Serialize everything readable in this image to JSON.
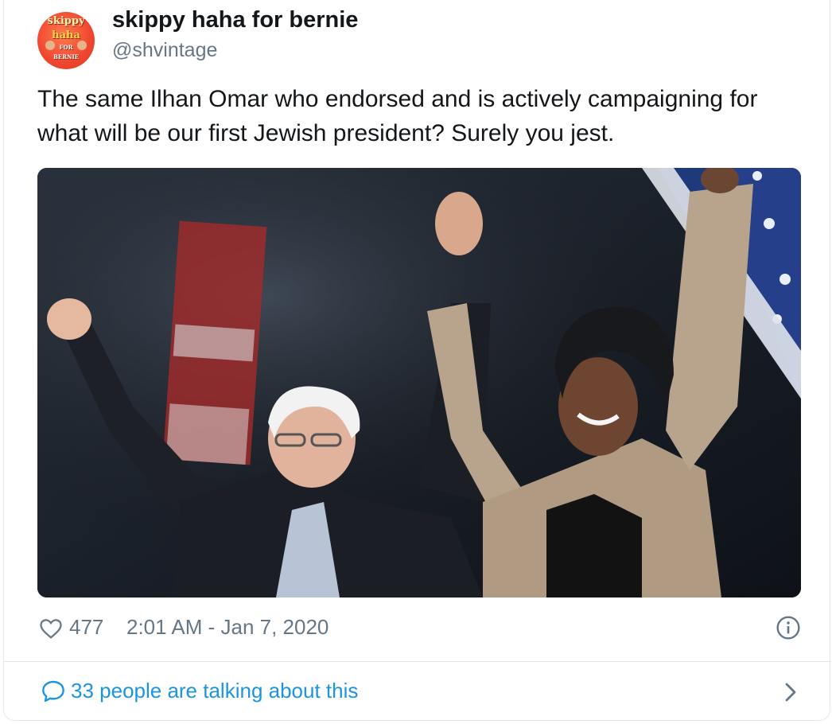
{
  "tweet": {
    "avatar": {
      "line1": "skippy",
      "line2": "haha",
      "line3": "FOR",
      "line4": "BERNIE"
    },
    "display_name": "skippy haha for bernie",
    "handle": "@shvintage",
    "text": "The same Ilhan Omar who endorsed and is actively campaigning for what will be our first Jewish president? Surely you jest.",
    "likes": "477",
    "timestamp": "2:01 AM - Jan 7, 2020",
    "talking": "33 people are talking about this"
  },
  "icons": {
    "like": "heart-icon",
    "info": "info-icon",
    "reply": "speech-bubble-icon",
    "chevron": "chevron-right-icon"
  },
  "colors": {
    "text": "#14171a",
    "secondary": "#657786",
    "link": "#1b95e0",
    "border": "#e1e8ed"
  }
}
